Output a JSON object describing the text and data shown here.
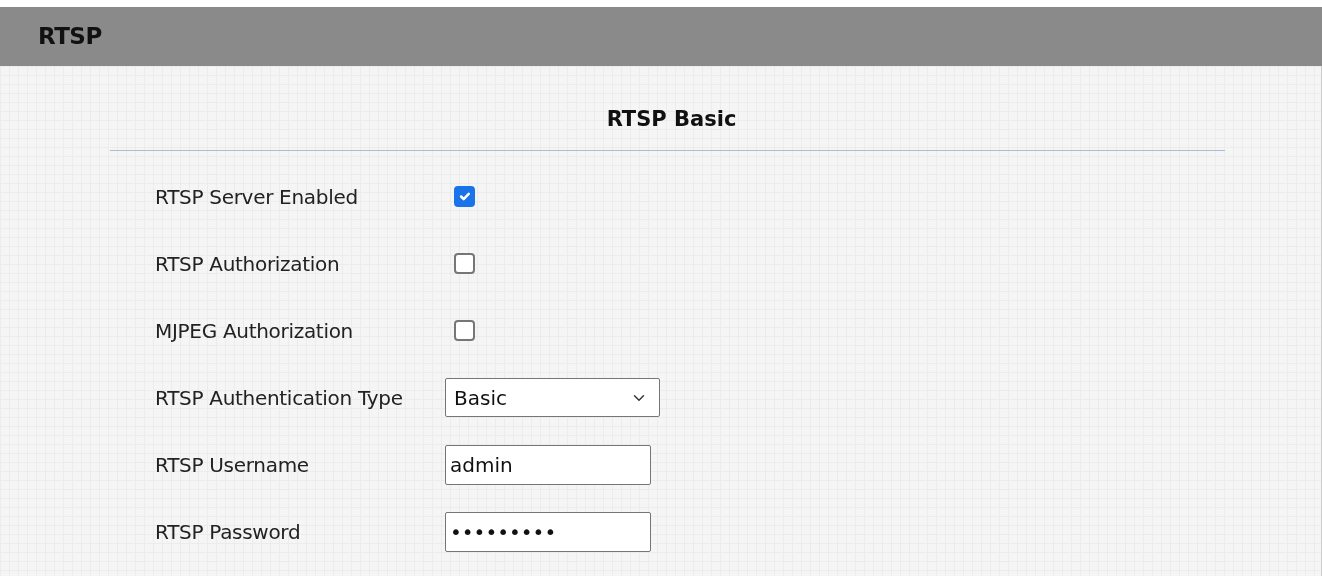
{
  "header": {
    "title": "RTSP"
  },
  "section": {
    "title": "RTSP Basic"
  },
  "fields": [
    {
      "kind": "checkbox",
      "label": "RTSP Server Enabled",
      "checked": true
    },
    {
      "kind": "checkbox",
      "label": "RTSP Authorization",
      "checked": false
    },
    {
      "kind": "checkbox",
      "label": "MJPEG Authorization",
      "checked": false
    },
    {
      "kind": "select",
      "label": "RTSP Authentication Type",
      "value": "Basic"
    },
    {
      "kind": "text",
      "label": "RTSP Username",
      "value": "admin"
    },
    {
      "kind": "text",
      "label": "RTSP Password",
      "value": "•••••••••"
    }
  ]
}
